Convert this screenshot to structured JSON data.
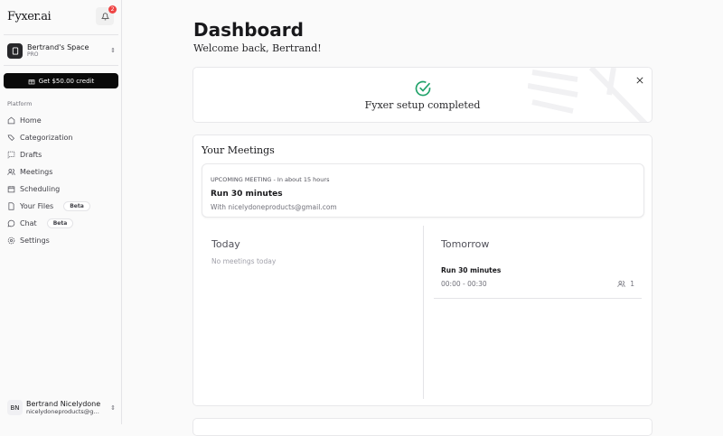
{
  "sidebar": {
    "logo": "Fyxer.ai",
    "notifications": "2",
    "space": {
      "name": "Bertrand's Space",
      "plan": "PRO"
    },
    "credit": "Get $50.00 credit",
    "section": "Platform",
    "items": [
      {
        "label": "Home"
      },
      {
        "label": "Categorization"
      },
      {
        "label": "Drafts"
      },
      {
        "label": "Meetings"
      },
      {
        "label": "Scheduling"
      },
      {
        "label": "Your Files",
        "badge": "Beta"
      },
      {
        "label": "Chat",
        "badge": "Beta"
      },
      {
        "label": "Settings"
      }
    ],
    "user": {
      "initials": "BN",
      "name": "Bertrand Nicelydone",
      "email": "nicelydoneproducts@gmail.com"
    }
  },
  "main": {
    "title": "Dashboard",
    "welcome": "Welcome back, Bertrand!",
    "setup": "Fyxer setup completed",
    "meetings": {
      "title": "Your Meetings",
      "upcoming": {
        "label": "UPCOMING MEETING",
        "when": " - In about 15 hours",
        "name": "Run 30 minutes",
        "with": "With nicelydoneproducts@gmail.com"
      },
      "today": {
        "title": "Today",
        "empty": "No meetings today"
      },
      "tomorrow": {
        "title": "Tomorrow",
        "items": [
          {
            "name": "Run 30 minutes",
            "time": "00:00 - 00:30",
            "attendees": "1"
          }
        ]
      }
    }
  }
}
